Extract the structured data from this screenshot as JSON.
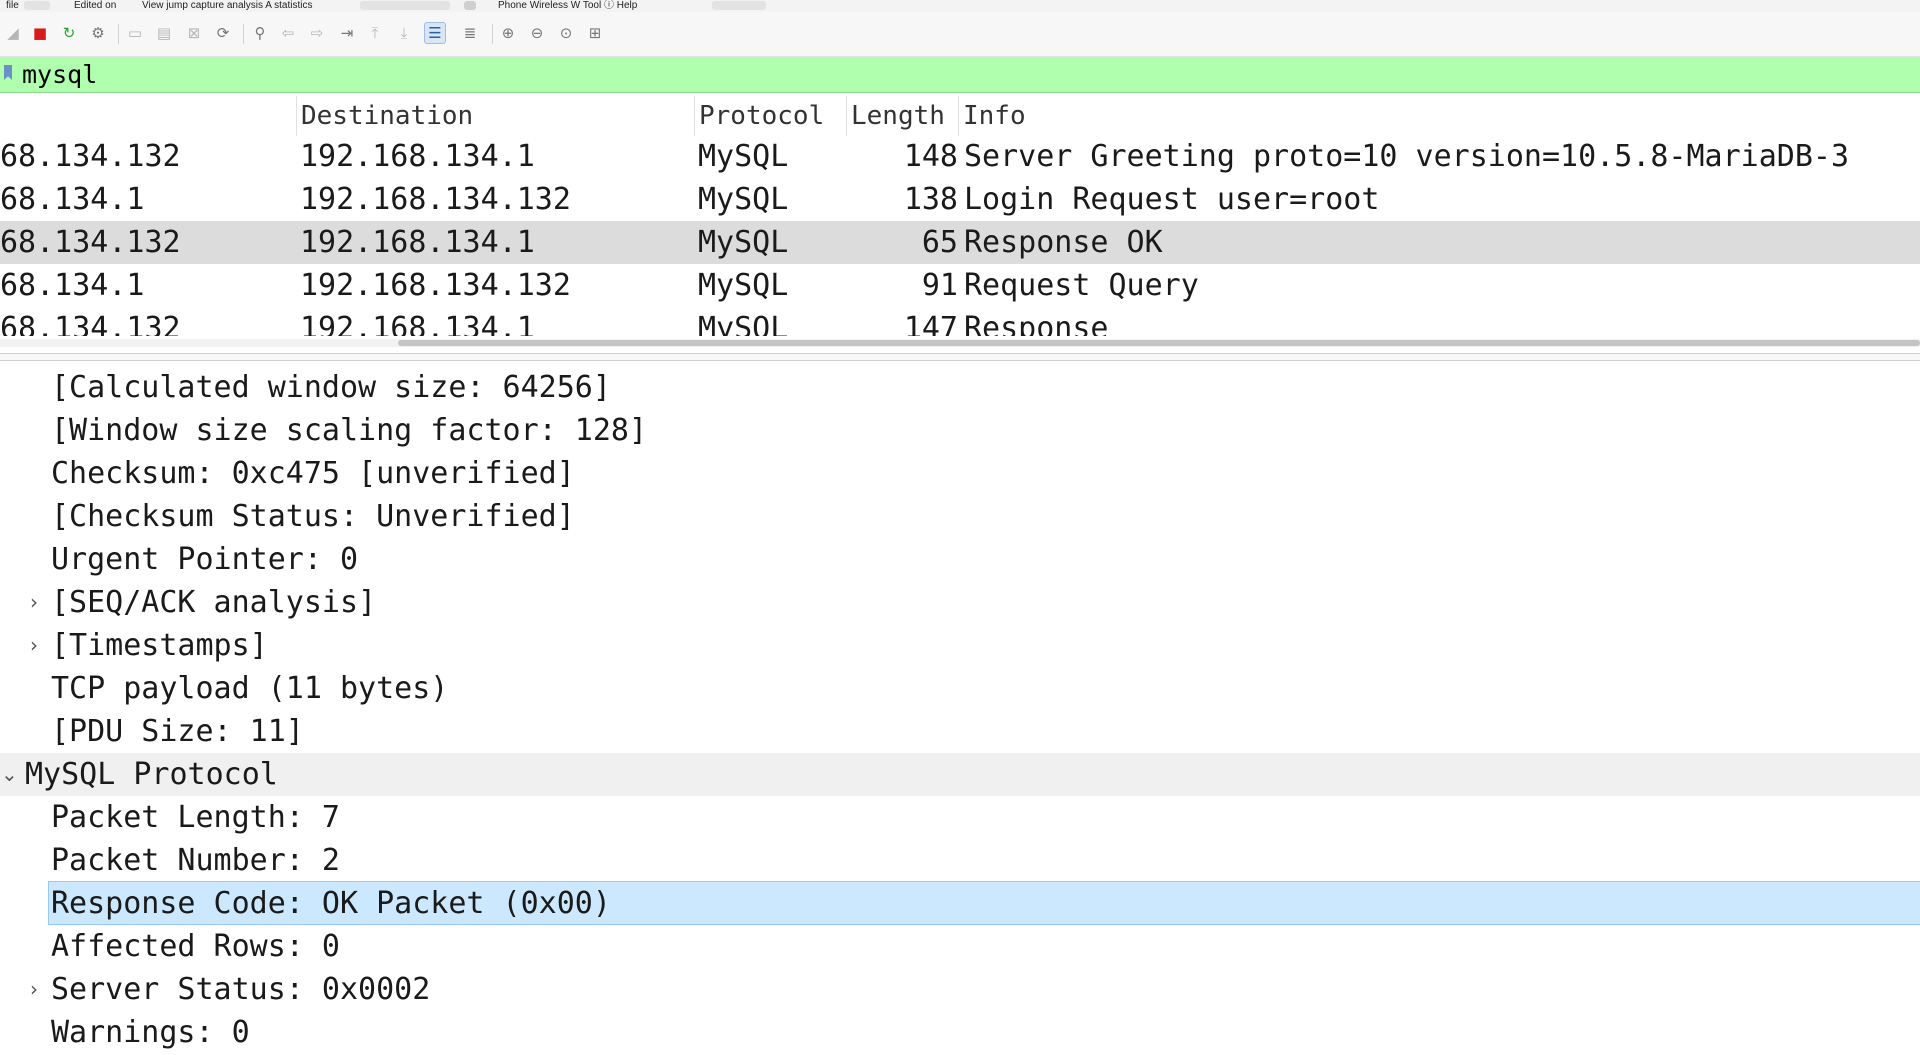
{
  "menubar": {
    "items": [
      "file",
      "Edited on",
      "View jump capture analysis A statistics",
      "Phone Wireless W Tool ⓘ Help"
    ]
  },
  "toolbar": {
    "icons": [
      "fin-icon",
      "stop-capture-icon",
      "restart-capture-icon",
      "capture-options-icon",
      "open-file-icon",
      "save-file-icon",
      "close-file-icon",
      "reload-icon",
      "find-packet-icon",
      "go-back-icon",
      "go-forward-icon",
      "go-to-packet-icon",
      "go-first-icon",
      "go-last-icon",
      "autoscroll-icon",
      "colorize-icon",
      "zoom-in-icon",
      "zoom-out-icon",
      "zoom-reset-icon",
      "resize-columns-icon"
    ]
  },
  "filter": {
    "value": "mysql"
  },
  "packet_list": {
    "columns": [
      "Destination",
      "Protocol",
      "Length",
      "Info"
    ],
    "rows": [
      {
        "src": "68.134.132",
        "dst": "192.168.134.1",
        "proto": "MySQL",
        "len": "148",
        "info": "Server Greeting proto=10 version=10.5.8-MariaDB-3"
      },
      {
        "src": "68.134.1",
        "dst": "192.168.134.132",
        "proto": "MySQL",
        "len": "138",
        "info": "Login Request user=root"
      },
      {
        "src": "68.134.132",
        "dst": "192.168.134.1",
        "proto": "MySQL",
        "len": "65",
        "info": "Response OK"
      },
      {
        "src": "68.134.1",
        "dst": "192.168.134.132",
        "proto": "MySQL",
        "len": "91",
        "info": "Request Query"
      },
      {
        "src": "68.134.132",
        "dst": "192.168.134.1",
        "proto": "MySQL",
        "len": "147",
        "info": "Response"
      }
    ],
    "selected_row": 2
  },
  "details": {
    "rows": [
      "[Calculated window size: 64256]",
      "[Window size scaling factor: 128]",
      "Checksum: 0xc475 [unverified]",
      "[Checksum Status: Unverified]",
      "Urgent Pointer: 0",
      "[SEQ/ACK analysis]",
      "[Timestamps]",
      "TCP payload (11 bytes)",
      "[PDU Size: 11]",
      "MySQL Protocol",
      "Packet Length: 7",
      "Packet Number: 2",
      "Response Code: OK Packet (0x00)",
      "Affected Rows: 0",
      "Server Status: 0x0002",
      "Warnings: 0"
    ],
    "caret_collapsed": "›",
    "caret_expanded": "⌄"
  },
  "colors": {
    "filter_valid": "#afffaf",
    "selected_packet": "#dcdcdc",
    "selected_field": "#cce8ff"
  }
}
